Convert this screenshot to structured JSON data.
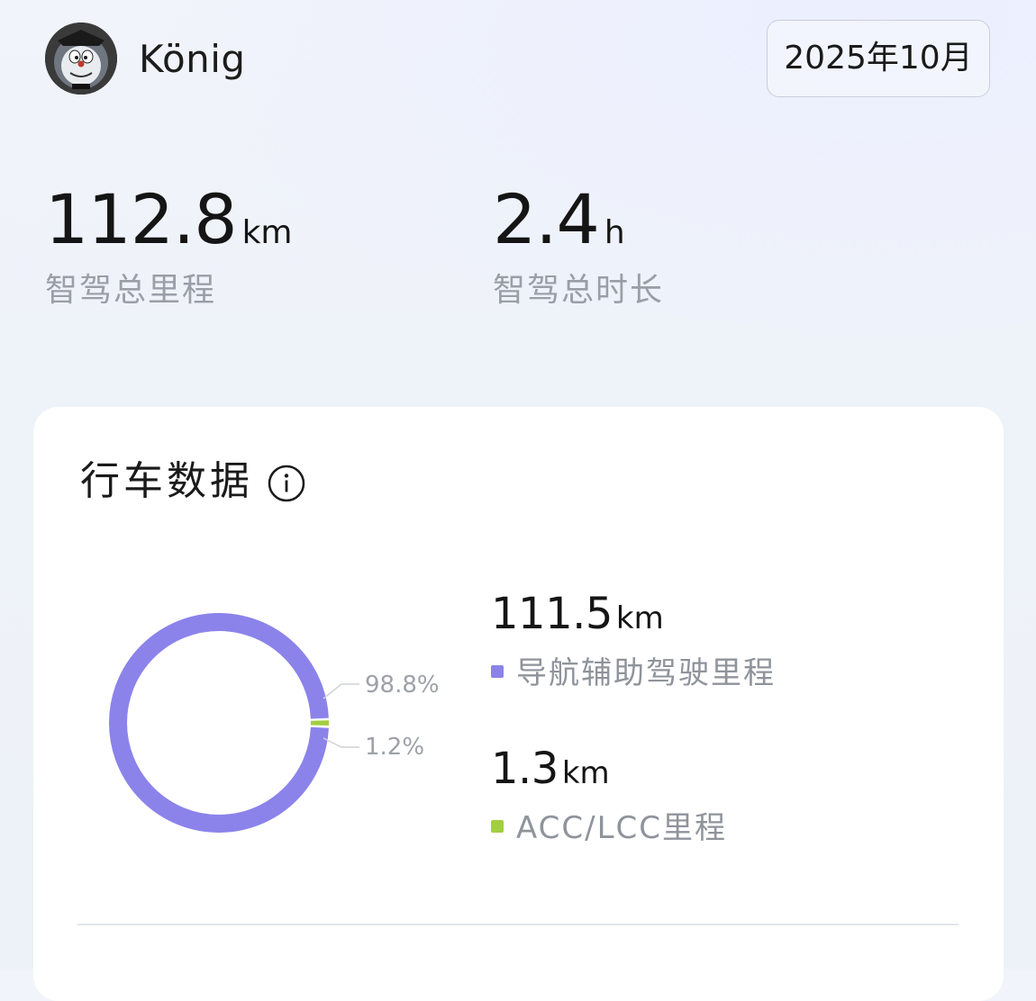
{
  "header": {
    "username": "König",
    "month_selector": "2025年10月"
  },
  "summary": {
    "total_distance": {
      "value": "112.8",
      "unit": "km",
      "label": "智驾总里程"
    },
    "total_duration": {
      "value": "2.4",
      "unit": "h",
      "label": "智驾总时长"
    }
  },
  "driving_card": {
    "title": "行车数据",
    "info_icon": "info-icon",
    "metrics": [
      {
        "value": "111.5",
        "unit": "km",
        "label": "导航辅助驾驶里程",
        "percent_label": "98.8%",
        "color": "#8b83ea"
      },
      {
        "value": "1.3",
        "unit": "km",
        "label": "ACC/LCC里程",
        "percent_label": "1.2%",
        "color": "#a3cf3f"
      }
    ]
  },
  "chart_data": {
    "type": "pie",
    "donut": true,
    "categories": [
      "导航辅助驾驶里程",
      "ACC/LCC里程"
    ],
    "values": [
      111.5,
      1.3
    ],
    "percent_labels": [
      "98.8%",
      "1.2%"
    ],
    "colors": [
      "#8b83ea",
      "#a3cf3f"
    ]
  }
}
